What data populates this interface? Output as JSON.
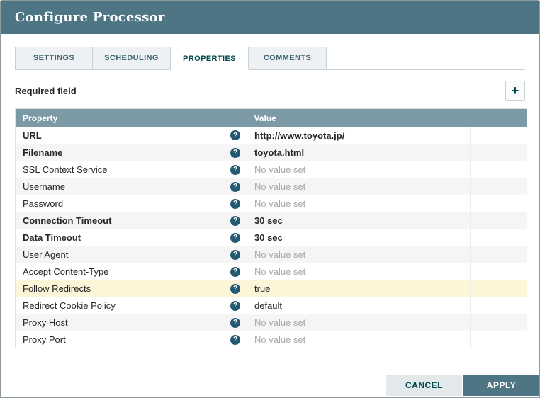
{
  "dialog": {
    "title": "Configure Processor"
  },
  "tabs": [
    {
      "label": "SETTINGS"
    },
    {
      "label": "SCHEDULING"
    },
    {
      "label": "PROPERTIES"
    },
    {
      "label": "COMMENTS"
    }
  ],
  "toolbar": {
    "required_field_label": "Required field",
    "add_button_glyph": "+"
  },
  "table": {
    "headers": [
      "Property",
      "Value"
    ],
    "help_glyph": "?",
    "rows": [
      {
        "property": "URL",
        "value": "http://www.toyota.jp/",
        "bold": true,
        "unset": false,
        "highlight": false
      },
      {
        "property": "Filename",
        "value": "toyota.html",
        "bold": true,
        "unset": false,
        "highlight": false
      },
      {
        "property": "SSL Context Service",
        "value": "No value set",
        "bold": false,
        "unset": true,
        "highlight": false
      },
      {
        "property": "Username",
        "value": "No value set",
        "bold": false,
        "unset": true,
        "highlight": false
      },
      {
        "property": "Password",
        "value": "No value set",
        "bold": false,
        "unset": true,
        "highlight": false
      },
      {
        "property": "Connection Timeout",
        "value": "30 sec",
        "bold": true,
        "unset": false,
        "highlight": false
      },
      {
        "property": "Data Timeout",
        "value": "30 sec",
        "bold": true,
        "unset": false,
        "highlight": false
      },
      {
        "property": "User Agent",
        "value": "No value set",
        "bold": false,
        "unset": true,
        "highlight": false
      },
      {
        "property": "Accept Content-Type",
        "value": "No value set",
        "bold": false,
        "unset": true,
        "highlight": false
      },
      {
        "property": "Follow Redirects",
        "value": "true",
        "bold": false,
        "unset": false,
        "highlight": true
      },
      {
        "property": "Redirect Cookie Policy",
        "value": "default",
        "bold": false,
        "unset": false,
        "highlight": false
      },
      {
        "property": "Proxy Host",
        "value": "No value set",
        "bold": false,
        "unset": true,
        "highlight": false
      },
      {
        "property": "Proxy Port",
        "value": "No value set",
        "bold": false,
        "unset": true,
        "highlight": false
      }
    ]
  },
  "footer": {
    "cancel_label": "CANCEL",
    "apply_label": "APPLY"
  },
  "colors": {
    "header_bg": "#4d7584",
    "table_header_bg": "#7c99a6",
    "accent": "#004849",
    "highlight_row": "#fdf5d8"
  }
}
